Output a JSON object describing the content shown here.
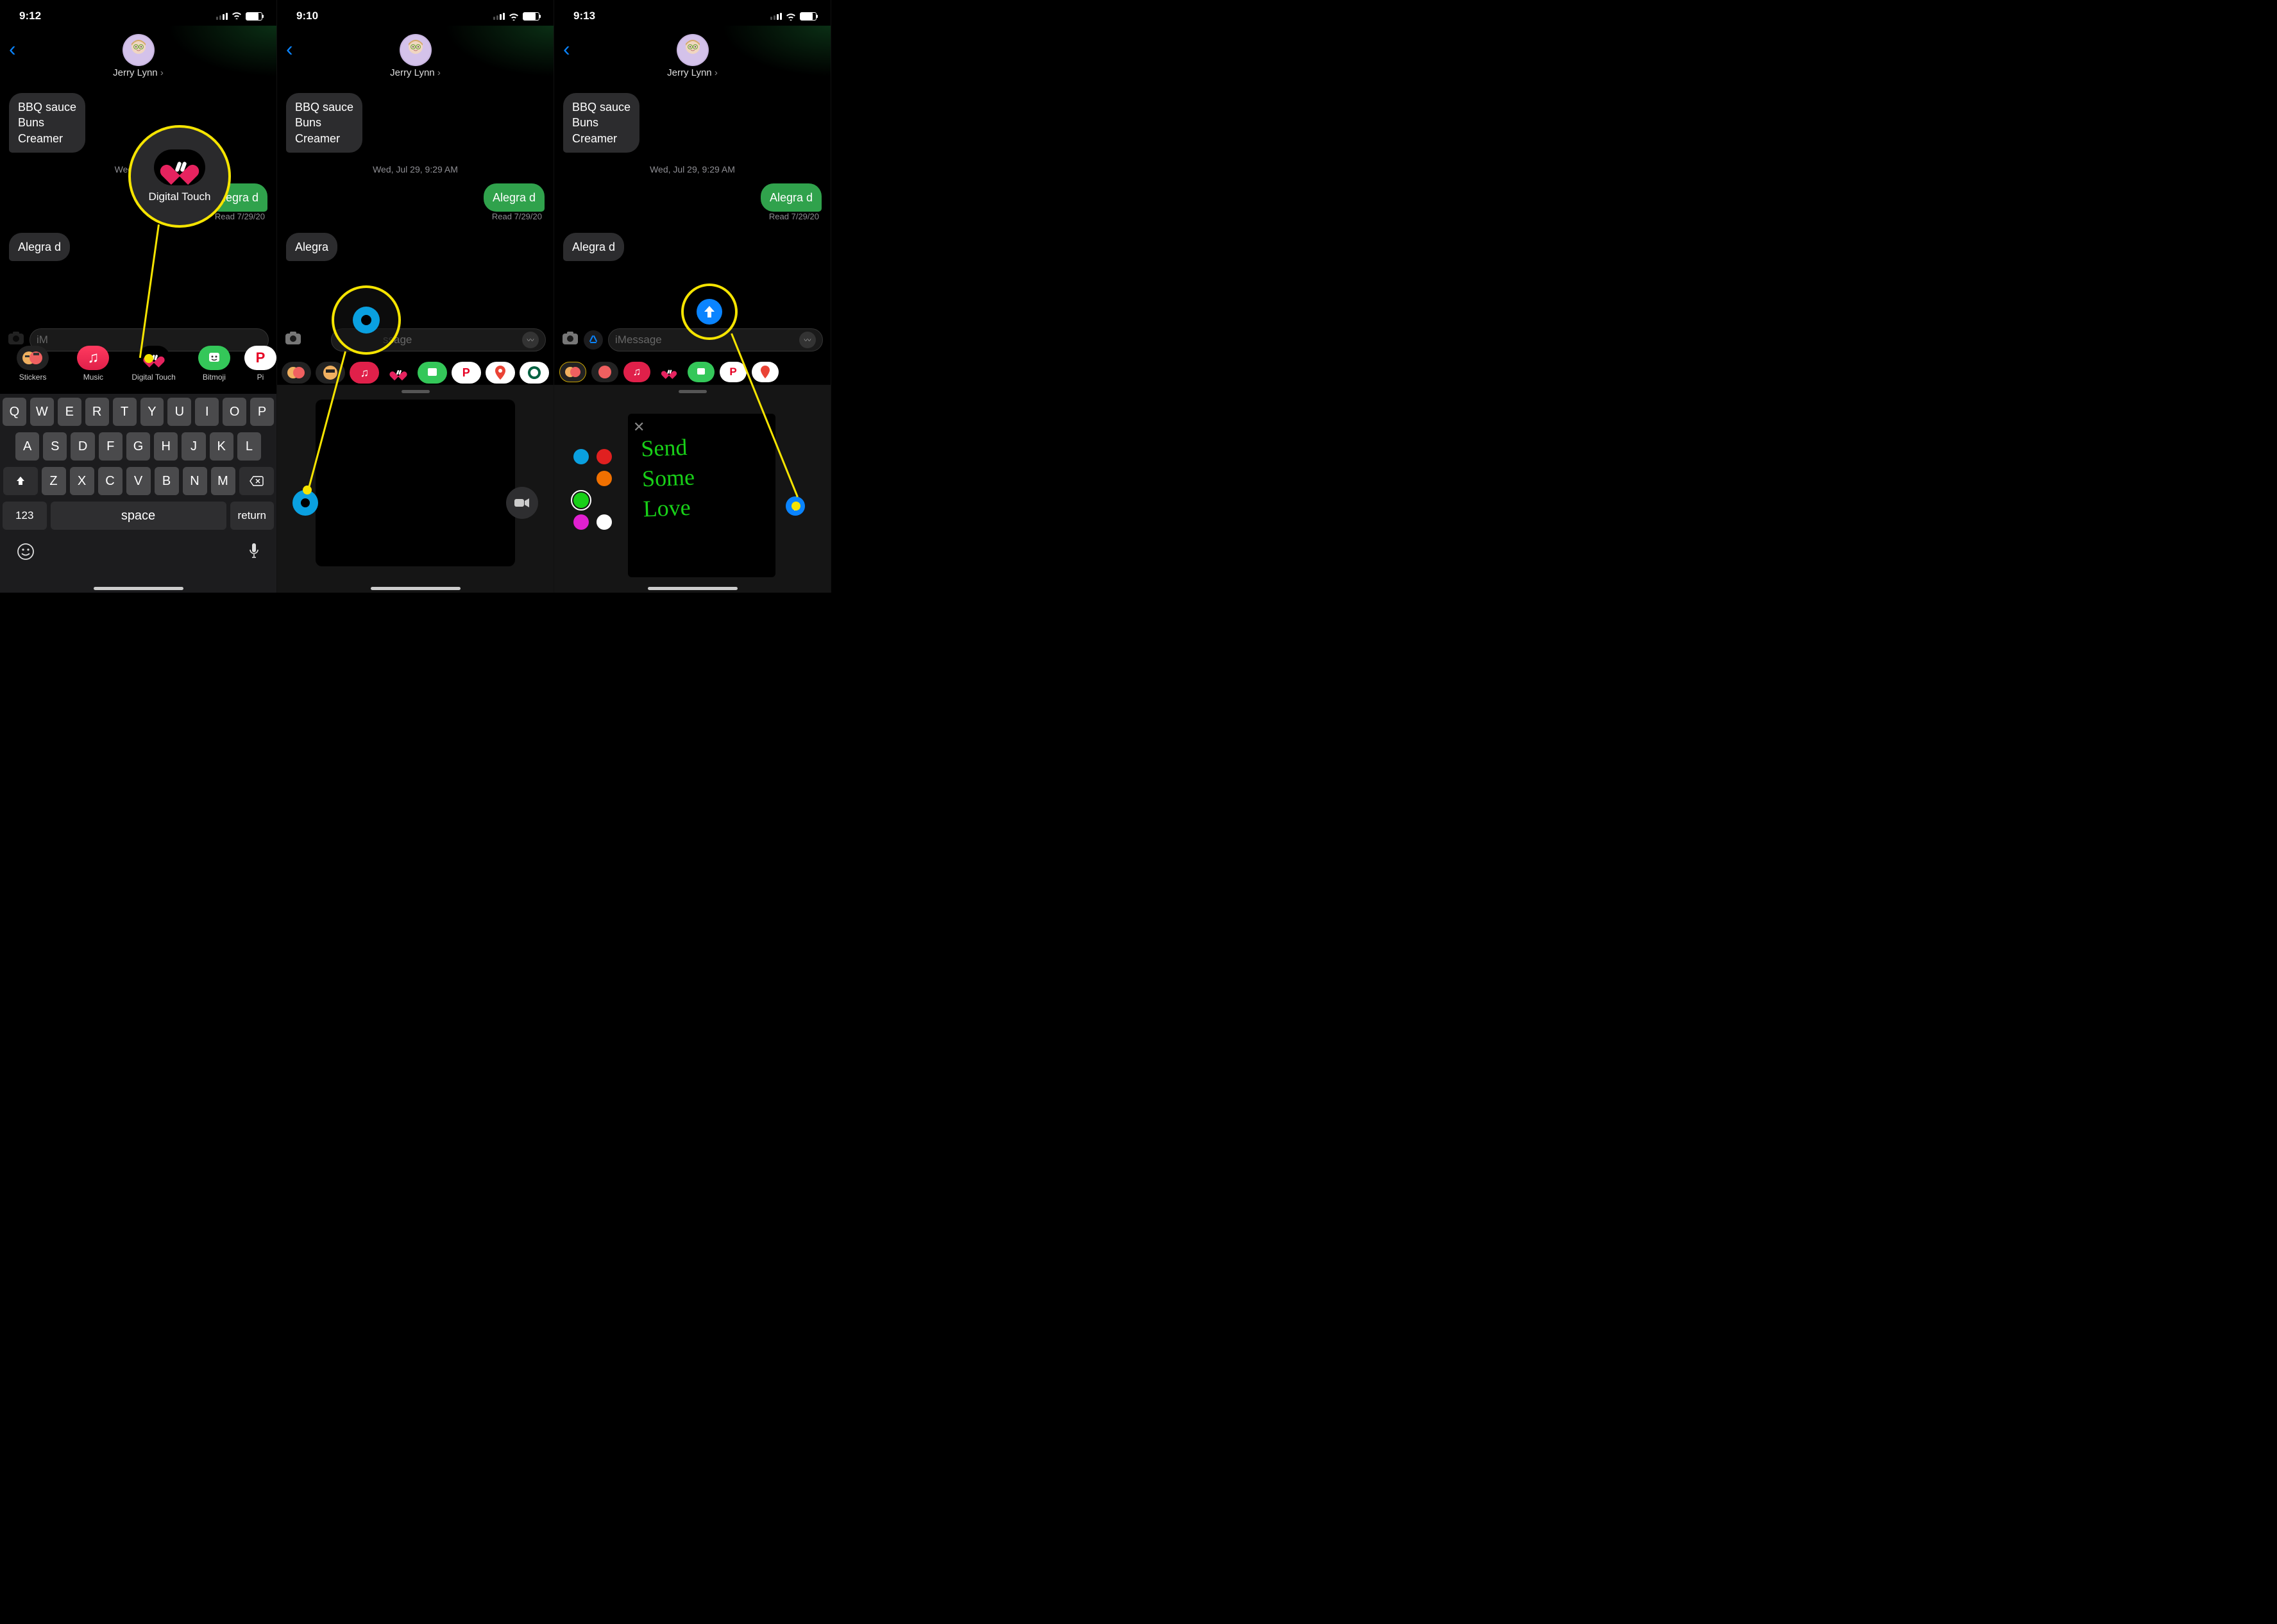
{
  "contact": "Jerry Lynn",
  "msg_in1_l1": "BBQ sauce",
  "msg_in1_l2": "Buns",
  "msg_in1_l3": "Creamer",
  "timestamp_full": "Wed, Jul 29, 9:29 AM",
  "timestamp_short": "Wed, Jul 29",
  "msg_out1": "Alegra d",
  "read_meta": "Read 7/29/20",
  "msg_in2": "Alegra d",
  "placeholder_im": "iMessage",
  "placeholder_ssage": "ssage",
  "digital_touch_label": "Digital Touch",
  "screens": {
    "s1": {
      "time": "9:12"
    },
    "s2": {
      "time": "9:10"
    },
    "s3": {
      "time": "9:13"
    }
  },
  "apps_labeled": [
    {
      "label": "Stickers"
    },
    {
      "label": "Music"
    },
    {
      "label": "Digital Touch"
    },
    {
      "label": "Bitmoji"
    },
    {
      "label": "Pi"
    }
  ],
  "kbd": {
    "r1": [
      "Q",
      "W",
      "E",
      "R",
      "T",
      "Y",
      "U",
      "I",
      "O",
      "P"
    ],
    "r2": [
      "A",
      "S",
      "D",
      "F",
      "G",
      "H",
      "J",
      "K",
      "L"
    ],
    "r3": [
      "Z",
      "X",
      "C",
      "V",
      "B",
      "N",
      "M"
    ],
    "num": "123",
    "space": "space",
    "ret": "return"
  },
  "scribble": {
    "l1": "Send",
    "l2": "Some",
    "l3": "Love"
  },
  "palette_colors": [
    "#0aa0e0",
    "#e02020",
    "#f07000",
    "#18d018",
    "#e020d0",
    "#ffffff"
  ]
}
